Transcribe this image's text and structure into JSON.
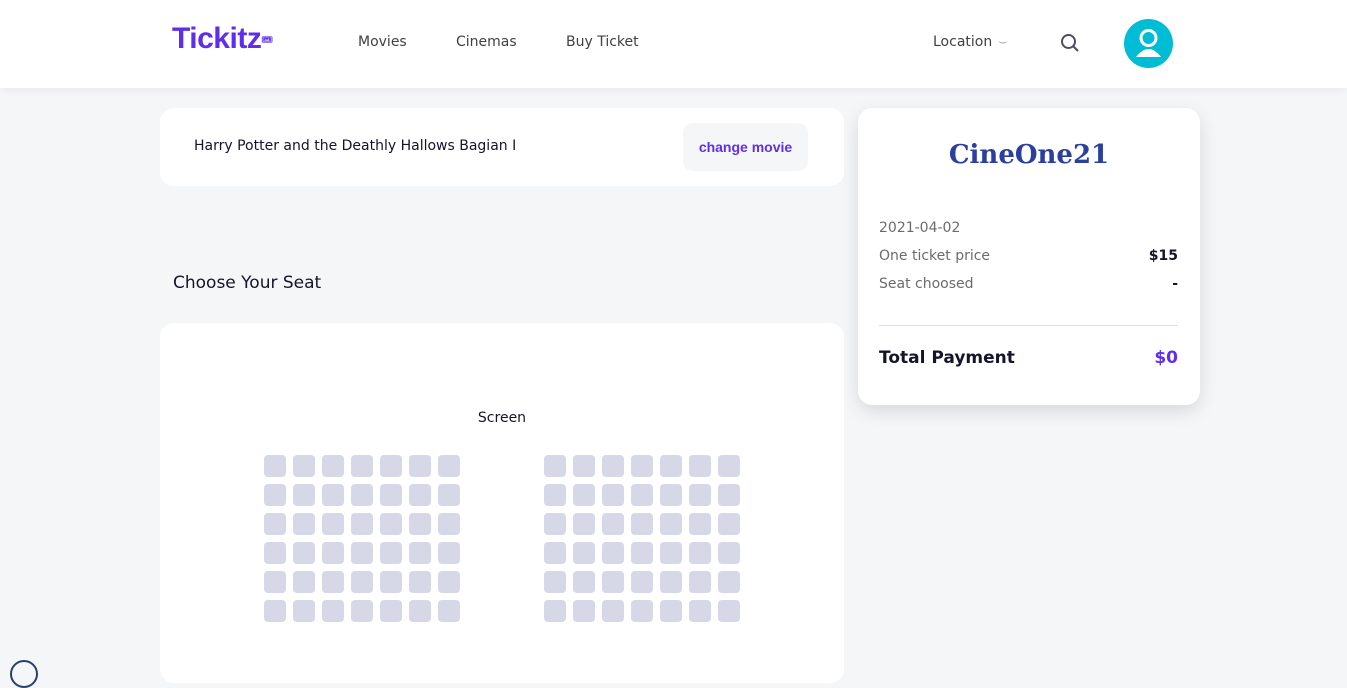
{
  "nav": {
    "logo": "Tickitz",
    "links": [
      "Movies",
      "Cinemas",
      "Buy Ticket"
    ],
    "location": "Location",
    "location_icon": "chevron-down-icon",
    "search_icon": "search-icon",
    "avatar_icon": "user-icon"
  },
  "movie": {
    "title": "Harry Potter and the Deathly Hallows Bagian I",
    "change_label": "change movie"
  },
  "seats": {
    "heading": "Choose Your Seat",
    "screen_label": "Screen",
    "rows": 6,
    "columns_per_block": 7,
    "blocks": 2,
    "seat_color": "#d6d8e7"
  },
  "order": {
    "cinema_logo": "CineOne21",
    "date": "2021-04-02",
    "price_label": "One ticket price",
    "price_value": "$15",
    "seat_label": "Seat choosed",
    "seat_value": "-",
    "total_label": "Total Payment",
    "total_value": "$0"
  },
  "colors": {
    "accent": "#5f2eea",
    "avatar": "#00bcd4"
  }
}
